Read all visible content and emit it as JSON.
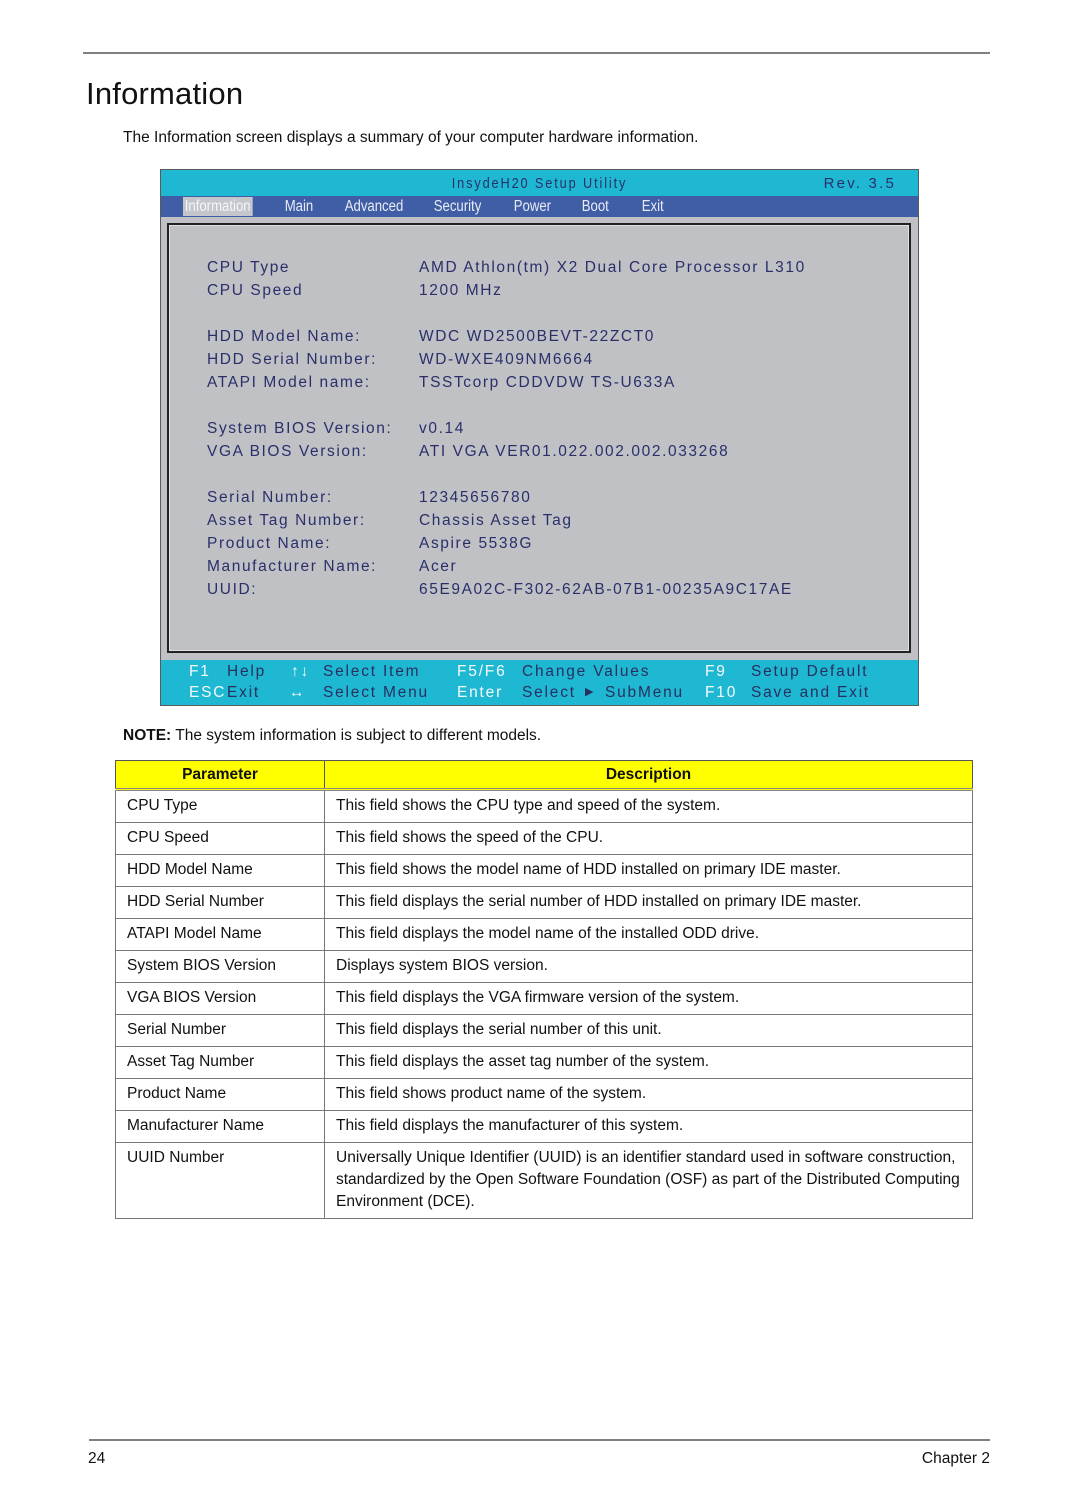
{
  "page": {
    "title": "Information",
    "intro": "The Information screen displays a summary of your computer hardware information.",
    "note_label": "NOTE:",
    "note_text": " The system information is subject to different models.",
    "page_number": "24",
    "chapter": "Chapter 2"
  },
  "bios": {
    "title": "InsydeH20 Setup Utility",
    "revision": "Rev. 3.5",
    "menu": [
      {
        "label": "Information",
        "active": true
      },
      {
        "label": "Main",
        "active": false
      },
      {
        "label": "Advanced",
        "active": false
      },
      {
        "label": "Security",
        "active": false
      },
      {
        "label": "Power",
        "active": false
      },
      {
        "label": "Boot",
        "active": false
      },
      {
        "label": "Exit",
        "active": false
      }
    ],
    "fields": [
      {
        "label": "CPU Type",
        "value": "AMD Athlon(tm) X2 Dual Core Processor L310"
      },
      {
        "label": "CPU Speed",
        "value": "1200 MHz"
      },
      {
        "label": "HDD Model Name:",
        "value": "WDC WD2500BEVT-22ZCT0"
      },
      {
        "label": "HDD Serial Number:",
        "value": "WD-WXE409NM6664"
      },
      {
        "label": "ATAPI Model name:",
        "value": "TSSTcorp CDDVDW TS-U633A"
      },
      {
        "label": "System BIOS Version:",
        "value": "v0.14"
      },
      {
        "label": "VGA BIOS Version:",
        "value": "ATI VGA VER01.022.002.002.033268"
      },
      {
        "label": "Serial Number:",
        "value": "12345656780"
      },
      {
        "label": "Asset Tag Number:",
        "value": "Chassis Asset Tag"
      },
      {
        "label": "Product Name:",
        "value": "Aspire 5538G"
      },
      {
        "label": "Manufacturer Name:",
        "value": "Acer"
      },
      {
        "label": "UUID:",
        "value": "65E9A02C-F302-62AB-07B1-00235A9C17AE"
      }
    ],
    "footer": {
      "f1_key": "F1",
      "f1_desc": "Help",
      "updown_icon": "↑↓",
      "updown_desc": "Select  Item",
      "f5f6_key": "F5/F6",
      "f5f6_desc": "Change  Values",
      "f9_key": "F9",
      "f9_desc": "Setup  Default",
      "esc_key": "ESC",
      "esc_desc": "Exit",
      "leftright_icon": "↔",
      "leftright_desc": "Select  Menu",
      "enter_key": "Enter",
      "enter_desc_a": "Select",
      "enter_arrow": "▶",
      "enter_desc_b": "SubMenu",
      "f10_key": "F10",
      "f10_desc": "Save  and  Exit"
    },
    "colors": {
      "title_bar": "#1fb8d3",
      "menu_bar": "#3f5ea6",
      "body": "#c0c1c5",
      "text": "#2a2f6a"
    }
  },
  "table": {
    "headers": [
      "Parameter",
      "Description"
    ],
    "header_color": "#ffff00",
    "rows": [
      {
        "param": "CPU Type",
        "desc": "This field shows the CPU type and speed of the system."
      },
      {
        "param": "CPU Speed",
        "desc": "This field shows the speed of the CPU."
      },
      {
        "param": "HDD Model Name",
        "desc": "This field shows the model name of HDD installed on primary IDE master."
      },
      {
        "param": "HDD Serial Number",
        "desc": "This field displays the serial number of HDD installed on primary IDE master."
      },
      {
        "param": "ATAPI Model Name",
        "desc": "This field displays the model name of the installed ODD drive."
      },
      {
        "param": "System BIOS Version",
        "desc": "Displays system BIOS version."
      },
      {
        "param": "VGA BIOS Version",
        "desc": "This field displays the VGA firmware version of the system."
      },
      {
        "param": "Serial Number",
        "desc": "This field displays the serial number of this unit."
      },
      {
        "param": "Asset Tag Number",
        "desc": "This field displays the asset tag number of the system."
      },
      {
        "param": "Product Name",
        "desc": "This field shows product name of the system."
      },
      {
        "param": "Manufacturer Name",
        "desc": "This field displays the manufacturer of this system."
      },
      {
        "param": "UUID Number",
        "desc": "Universally Unique Identifier (UUID) is an identifier standard used in software construction, standardized by the Open Software Foundation (OSF) as part of the Distributed Computing Environment (DCE)."
      }
    ]
  }
}
